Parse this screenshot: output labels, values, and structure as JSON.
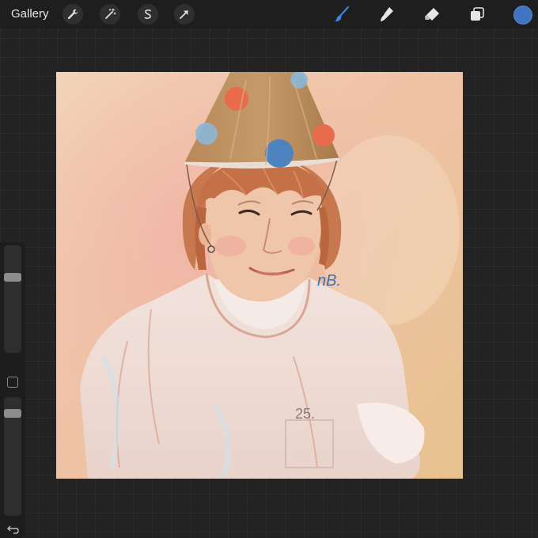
{
  "topbar": {
    "gallery_label": "Gallery",
    "left_tools": [
      {
        "name": "wrench-icon"
      },
      {
        "name": "magic-wand-icon"
      },
      {
        "name": "selection-s-icon"
      },
      {
        "name": "transform-arrow-icon"
      }
    ],
    "right_tools": [
      {
        "name": "brush-icon",
        "color": "#3e82e0",
        "active": true
      },
      {
        "name": "smudge-icon",
        "color": "#e6e6e6"
      },
      {
        "name": "eraser-icon",
        "color": "#e6e6e6"
      },
      {
        "name": "layers-icon",
        "color": "#e6e6e6"
      }
    ],
    "current_color": "#3e74c1"
  },
  "sidebar": {
    "brush_size_level": 0.3,
    "opacity_level": 0.1,
    "modifier_icon": "square-modifier-icon",
    "undo_icon": "undo-icon"
  },
  "canvas": {
    "artwork_signature": "nB.",
    "shirt_text": "25."
  }
}
